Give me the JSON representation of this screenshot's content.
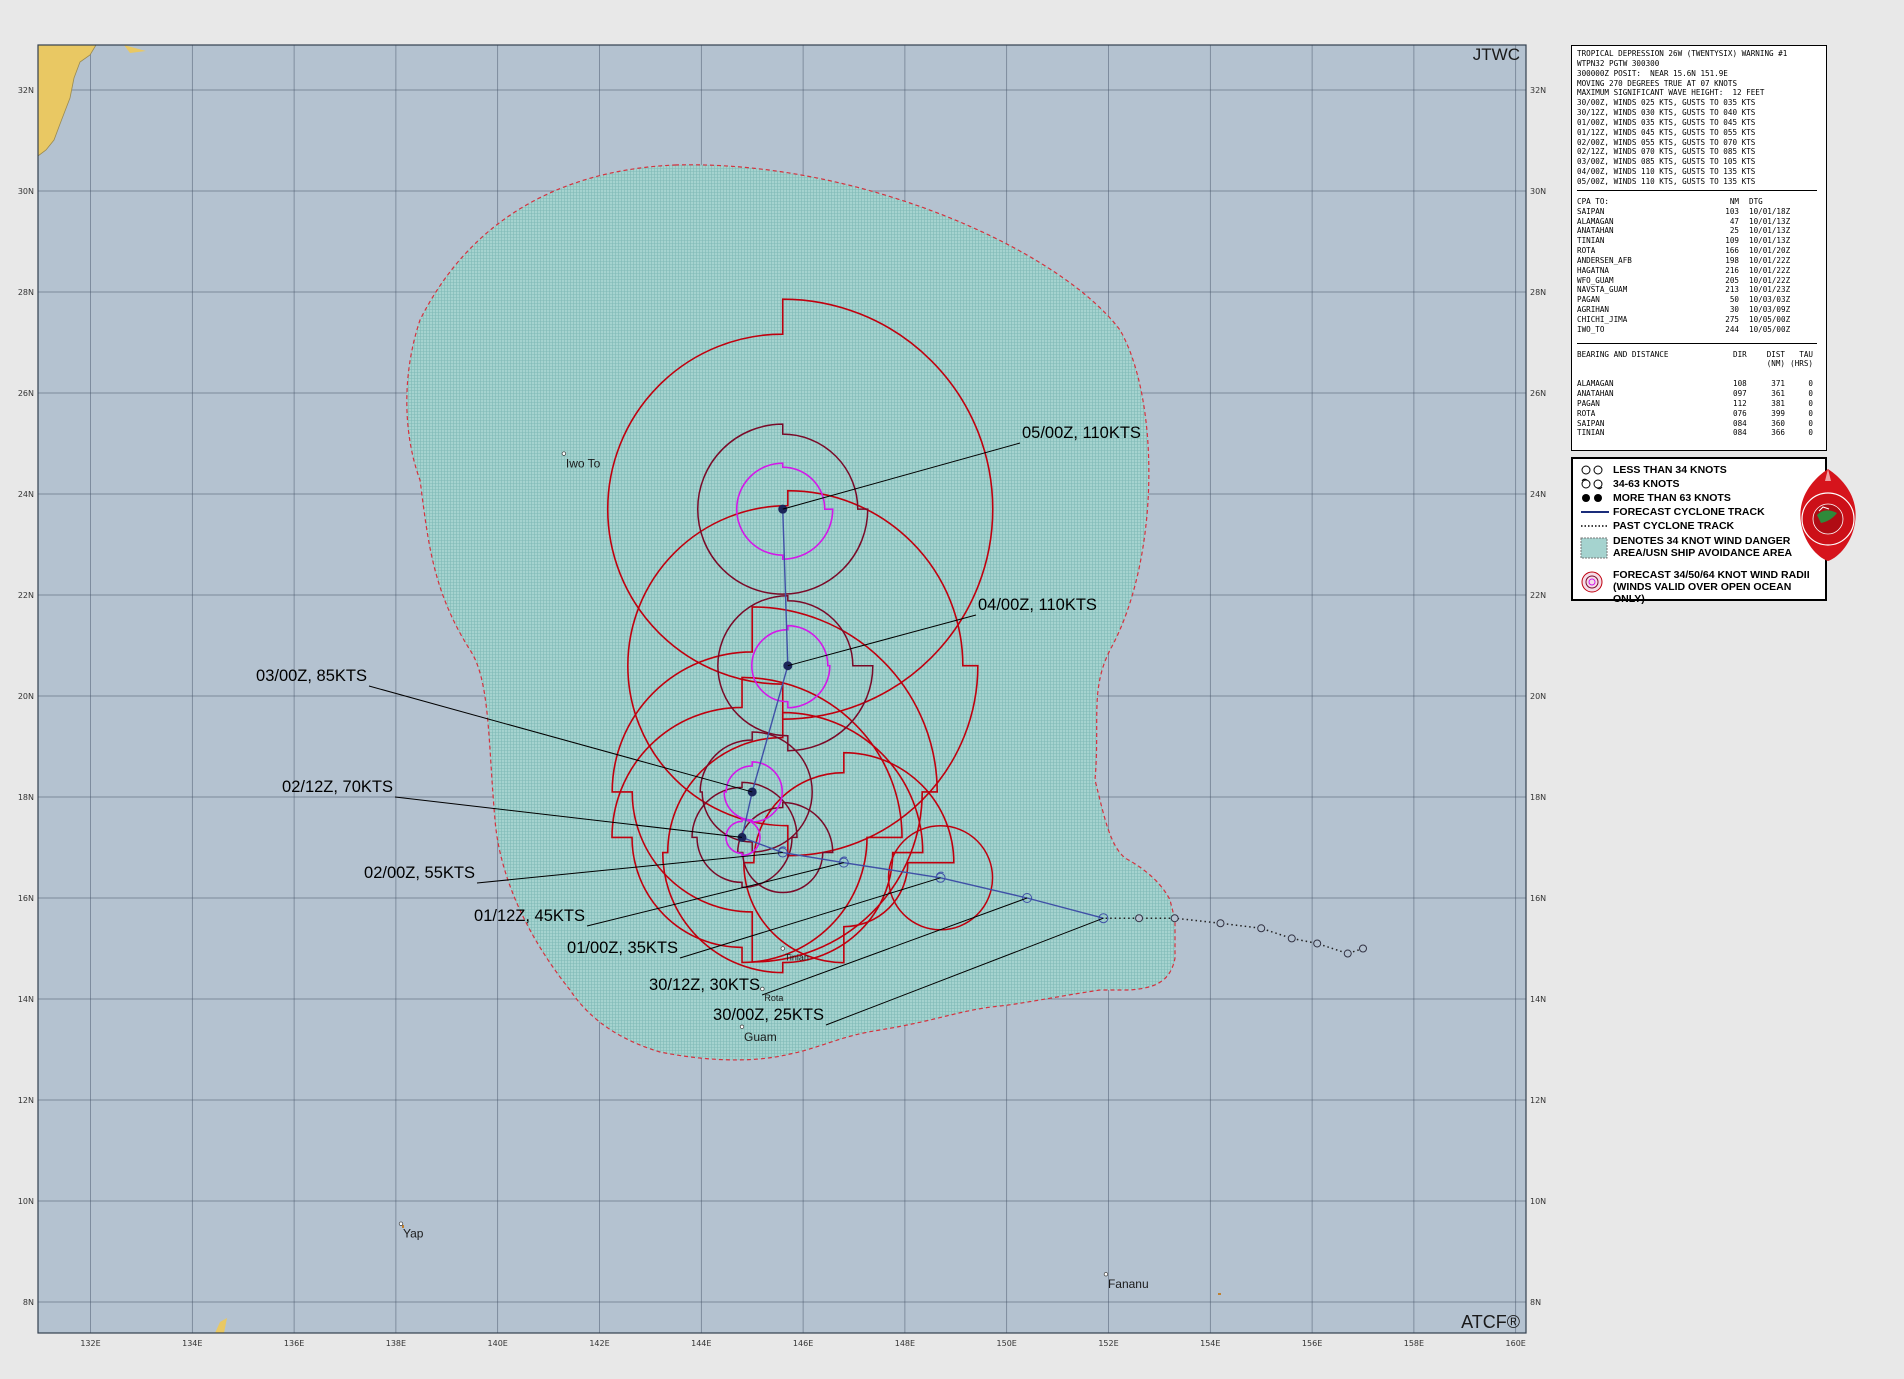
{
  "header": {
    "agency": "JTWC",
    "footer": "ATCF®"
  },
  "map": {
    "lon_range": [
      131,
      160.2
    ],
    "lat_range": [
      7.5,
      32.8
    ],
    "lon_ticks": [
      "132E",
      "134E",
      "136E",
      "138E",
      "140E",
      "142E",
      "144E",
      "146E",
      "148E",
      "150E",
      "152E",
      "154E",
      "156E",
      "158E",
      "160E"
    ],
    "lat_ticks": [
      "8N",
      "10N",
      "12N",
      "14N",
      "16N",
      "18N",
      "20N",
      "22N",
      "24N",
      "26N",
      "28N",
      "30N",
      "32N"
    ],
    "places": [
      {
        "name": "Iwo To",
        "lon": 141.3,
        "lat": 24.8
      },
      {
        "name": "Tinian",
        "lon": 145.6,
        "lat": 15.0
      },
      {
        "name": "Rota",
        "lon": 145.2,
        "lat": 14.2
      },
      {
        "name": "Guam",
        "lon": 144.8,
        "lat": 13.45
      },
      {
        "name": "Yap",
        "lon": 138.1,
        "lat": 9.55
      },
      {
        "name": "Fananu",
        "lon": 151.95,
        "lat": 8.55
      }
    ],
    "colors": {
      "ocean": "#b4c2d0",
      "land": "#e9c863",
      "grid": "#48566a",
      "danger": "#9fd2ce",
      "radius34": "#c0000e",
      "radius50": "#7a0a28",
      "radius64": "#d319e8",
      "track": "#3f50a6",
      "label_line": "#000000"
    }
  },
  "track": {
    "past": [
      {
        "lon": 157.0,
        "lat": 15.0
      },
      {
        "lon": 156.7,
        "lat": 14.9
      },
      {
        "lon": 156.1,
        "lat": 15.1
      },
      {
        "lon": 155.6,
        "lat": 15.2
      },
      {
        "lon": 155.0,
        "lat": 15.4
      },
      {
        "lon": 154.2,
        "lat": 15.5
      },
      {
        "lon": 153.3,
        "lat": 15.6
      },
      {
        "lon": 152.6,
        "lat": 15.6
      }
    ],
    "forecast": [
      {
        "label": "30/00Z,  25KTS",
        "lon": 151.9,
        "lat": 15.6,
        "intensity": "lt34",
        "label_at": [
          826,
          1025
        ]
      },
      {
        "label": "30/12Z,  30KTS",
        "lon": 150.4,
        "lat": 16.0,
        "intensity": "lt34",
        "label_at": [
          762,
          995
        ]
      },
      {
        "label": "01/00Z,  35KTS",
        "lon": 148.7,
        "lat": 16.4,
        "intensity": "34to63",
        "label_at": [
          680,
          958
        ]
      },
      {
        "label": "01/12Z,  45KTS",
        "lon": 146.8,
        "lat": 16.7,
        "intensity": "34to63",
        "label_at": [
          587,
          926
        ]
      },
      {
        "label": "02/00Z,  55KTS",
        "lon": 145.6,
        "lat": 16.9,
        "intensity": "34to63",
        "label_at": [
          477,
          883
        ]
      },
      {
        "label": "02/12Z,  70KTS",
        "lon": 144.8,
        "lat": 17.2,
        "intensity": "gt63",
        "label_at": [
          395,
          797
        ]
      },
      {
        "label": "03/00Z,  85KTS",
        "lon": 145.0,
        "lat": 18.1,
        "intensity": "gt63",
        "label_at": [
          369,
          686
        ]
      },
      {
        "label": "04/00Z,  110KTS",
        "lon": 145.7,
        "lat": 20.6,
        "intensity": "gt63",
        "label_at": [
          976,
          615
        ]
      },
      {
        "label": "05/00Z,  110KTS",
        "lon": 145.6,
        "lat": 23.7,
        "intensity": "gt63",
        "label_at": [
          1020,
          443
        ]
      }
    ]
  },
  "warning": {
    "lines": [
      "TROPICAL DEPRESSION 26W (TWENTYSIX) WARNING #1",
      "WTPN32 PGTW 300300",
      "300000Z POSIT:  NEAR 15.6N 151.9E",
      "MOVING 270 DEGREES TRUE AT 07 KNOTS",
      "MAXIMUM SIGNIFICANT WAVE HEIGHT:  12 FEET",
      "30/00Z, WINDS 025 KTS, GUSTS TO 035 KTS",
      "30/12Z, WINDS 030 KTS, GUSTS TO 040 KTS",
      "01/00Z, WINDS 035 KTS, GUSTS TO 045 KTS",
      "01/12Z, WINDS 045 KTS, GUSTS TO 055 KTS",
      "02/00Z, WINDS 055 KTS, GUSTS TO 070 KTS",
      "02/12Z, WINDS 070 KTS, GUSTS TO 085 KTS",
      "03/00Z, WINDS 085 KTS, GUSTS TO 105 KTS",
      "04/00Z, WINDS 110 KTS, GUSTS TO 135 KTS",
      "05/00Z, WINDS 110 KTS, GUSTS TO 135 KTS"
    ],
    "cpa_header": [
      "CPA TO:",
      "NM",
      "DTG"
    ],
    "cpa": [
      [
        "SAIPAN",
        "103",
        "10/01/18Z"
      ],
      [
        "ALAMAGAN",
        "47",
        "10/01/13Z"
      ],
      [
        "ANATAHAN",
        "25",
        "10/01/13Z"
      ],
      [
        "TINIAN",
        "109",
        "10/01/13Z"
      ],
      [
        "ROTA",
        "166",
        "10/01/20Z"
      ],
      [
        "ANDERSEN_AFB",
        "198",
        "10/01/22Z"
      ],
      [
        "HAGATNA",
        "216",
        "10/01/22Z"
      ],
      [
        "WFO_GUAM",
        "205",
        "10/01/22Z"
      ],
      [
        "NAVSTA_GUAM",
        "213",
        "10/01/23Z"
      ],
      [
        "PAGAN",
        "50",
        "10/03/03Z"
      ],
      [
        "AGRIHAN",
        "30",
        "10/03/09Z"
      ],
      [
        "CHICHI_JIMA",
        "275",
        "10/05/00Z"
      ],
      [
        "IWO_TO",
        "244",
        "10/05/00Z"
      ]
    ],
    "bd_header": [
      "BEARING AND DISTANCE",
      "DIR",
      "DIST",
      "TAU"
    ],
    "bd_units": [
      "(NM)",
      "(HRS)"
    ],
    "bd": [
      [
        "ALAMAGAN",
        "108",
        "371",
        "0"
      ],
      [
        "ANATAHAN",
        "097",
        "361",
        "0"
      ],
      [
        "PAGAN",
        "112",
        "381",
        "0"
      ],
      [
        "ROTA",
        "076",
        "399",
        "0"
      ],
      [
        "SAIPAN",
        "084",
        "360",
        "0"
      ],
      [
        "TINIAN",
        "084",
        "366",
        "0"
      ]
    ]
  },
  "legend": {
    "items": [
      "LESS THAN 34 KNOTS",
      "34-63 KNOTS",
      "MORE THAN 63 KNOTS",
      "FORECAST CYCLONE TRACK",
      "PAST CYCLONE TRACK",
      "DENOTES 34 KNOT WIND DANGER",
      "AREA/USN SHIP AVOIDANCE AREA",
      "FORECAST 34/50/64 KNOT WIND RADII",
      "(WINDS VALID OVER OPEN OCEAN ONLY)"
    ],
    "seal_icon": "jtwc-seal-icon"
  }
}
